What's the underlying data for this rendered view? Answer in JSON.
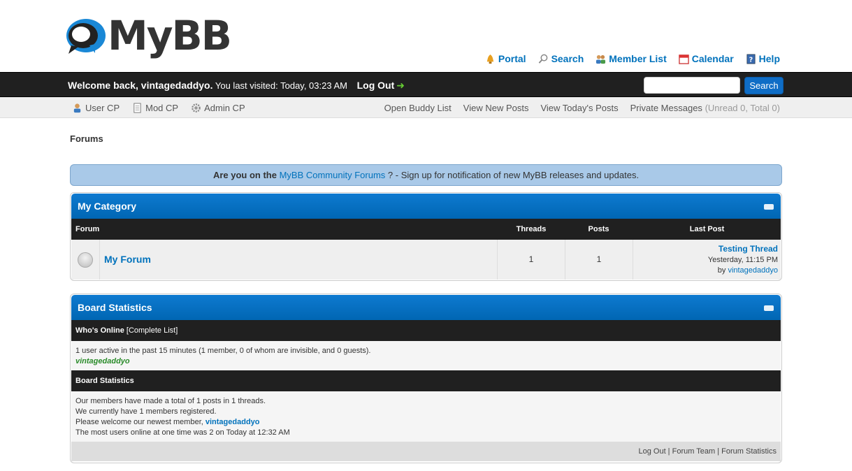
{
  "brand": {
    "logo_text": "MyBB"
  },
  "top_menu": [
    {
      "label": "Portal",
      "icon": "portal-icon"
    },
    {
      "label": "Search",
      "icon": "search-icon"
    },
    {
      "label": "Member List",
      "icon": "members-icon"
    },
    {
      "label": "Calendar",
      "icon": "calendar-icon"
    },
    {
      "label": "Help",
      "icon": "help-icon"
    }
  ],
  "panel": {
    "welcome": "Welcome back, vintagedaddyo.",
    "last_visited": "You last visited: Today, 03:23 AM",
    "logout": "Log Out",
    "search_button": "Search",
    "search_value": ""
  },
  "nav2": {
    "left": [
      "User CP",
      "Mod CP",
      "Admin CP"
    ],
    "right": [
      "Open Buddy List",
      "View New Posts",
      "View Today's Posts"
    ],
    "pm_label": "Private Messages",
    "pm_counts": "(Unread 0, Total 0)"
  },
  "breadcrumb": "Forums",
  "notice": {
    "prefix": "Are you on the",
    "link": "MyBB Community Forums",
    "suffix": "? - Sign up for notification of new MyBB releases and updates."
  },
  "category": {
    "title": "My Category",
    "columns": {
      "forum": "Forum",
      "threads": "Threads",
      "posts": "Posts",
      "last_post": "Last Post"
    },
    "rows": [
      {
        "name": "My Forum",
        "threads": "1",
        "posts": "1",
        "last_post_title": "Testing Thread",
        "last_post_time": "Yesterday, 11:15 PM",
        "last_post_by_label": "by",
        "last_post_author": "vintagedaddyo"
      }
    ]
  },
  "stats": {
    "title": "Board Statistics",
    "online_header": "Who's Online",
    "online_link": "[Complete List]",
    "online_text": "1 user active in the past 15 minutes (1 member, 0 of whom are invisible, and 0 guests).",
    "online_user": "vintagedaddyo",
    "stats_header": "Board Statistics",
    "line1": "Our members have made a total of 1 posts in 1 threads.",
    "line2": "We currently have 1 members registered.",
    "line3_prefix": "Please welcome our newest member,",
    "line3_user": "vintagedaddyo",
    "line4": "The most users online at one time was 2 on Today at 12:32 AM",
    "footer_links": [
      "Log Out",
      "Forum Team",
      "Forum Statistics"
    ]
  },
  "colors": {
    "accent_blue": "#0072bc",
    "header_bar": "#202020",
    "notice_bg": "#a9c9e8"
  }
}
